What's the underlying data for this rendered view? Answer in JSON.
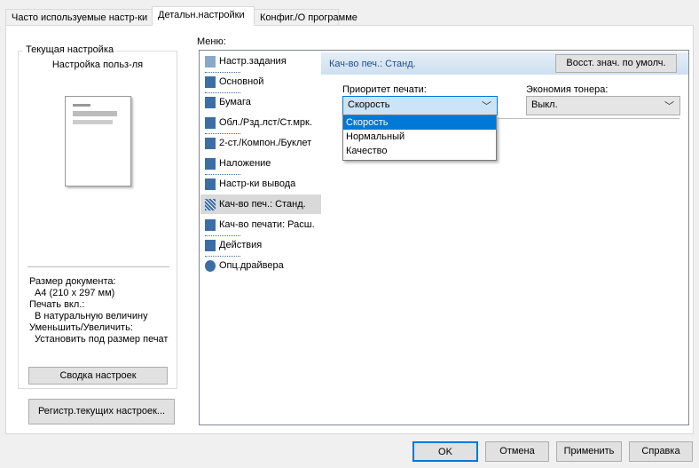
{
  "tabs": [
    "Часто используемые настр-ки",
    "Детальн.настройки",
    "Конфиг./О программе"
  ],
  "left": {
    "group_title": "Текущая настройка",
    "setting_name": "Настройка польз-ля",
    "info": [
      "Размер документа:",
      "A4 (210 x 297 мм)",
      "Печать вкл.:",
      "В натуральную величину",
      "Уменьшить/Увеличить:",
      "Установить под размер печат"
    ],
    "summary_button": "Сводка настроек",
    "register_button": "Регистр.текущих настроек..."
  },
  "menu": {
    "label": "Меню:",
    "items": [
      "Настр.задания",
      "Основной",
      "Бумага",
      "Обл./Рзд.лст/Ст.мрк.",
      "2-ст./Компон./Буклет",
      "Наложение",
      "Настр-ки вывода",
      "Кач-во печ.: Станд.",
      "Кач-во печати: Расш.",
      "Действия",
      "Опц.драйвера"
    ],
    "selected": 7
  },
  "content": {
    "title": "Кач-во печ.: Станд.",
    "restore_button": "Восст. знач. по умолч.",
    "priority_label": "Приоритет печати:",
    "priority_value": "Скорость",
    "priority_options": [
      "Скорость",
      "Нормальный",
      "Качество"
    ],
    "toner_label": "Экономия тонера:",
    "toner_value": "Выкл."
  },
  "buttons": {
    "ok": "OK",
    "cancel": "Отмена",
    "apply": "Применить",
    "help": "Справка"
  }
}
